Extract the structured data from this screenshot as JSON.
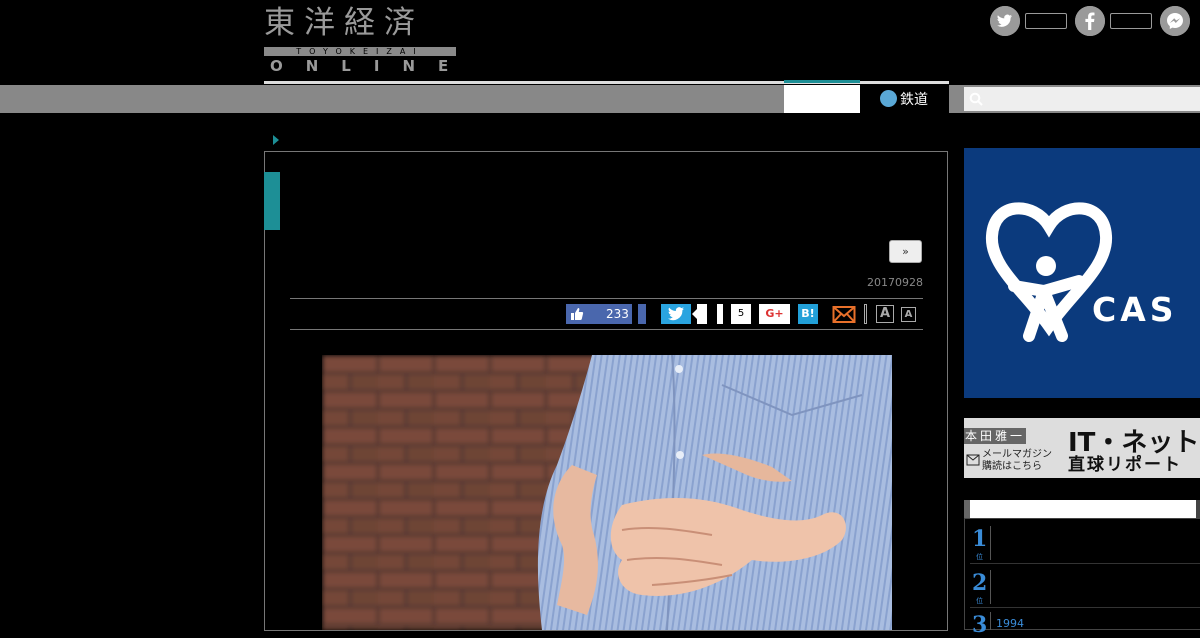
{
  "header": {
    "logo_kanji": "東洋経済",
    "logo_romaji": "TOYOKEIZAI",
    "logo_online": "ONLINE"
  },
  "social": [
    {
      "icon": "twitter-icon",
      "glyph": "t"
    },
    {
      "icon": "facebook-icon",
      "glyph": "f"
    },
    {
      "icon": "messenger-icon",
      "glyph": "m"
    }
  ],
  "nav": {
    "rail_label": "鉄道",
    "search_placeholder": ""
  },
  "article": {
    "next_button": "»",
    "date": "20170928",
    "share": {
      "fb_like_count": "233",
      "count_5": "5",
      "gplus_label": "G+",
      "hatena_label": "B!",
      "font_large": "A",
      "font_small": "A"
    }
  },
  "sidebar": {
    "ad_text": "CAS",
    "banner": {
      "name": "本田雅一",
      "mail_line1": "メールマガジン",
      "mail_line2": "購読はこちら",
      "title": "IT・ネット",
      "subtitle": "直球リポート"
    },
    "ranking": [
      {
        "rank": "1",
        "unit": "位",
        "text": ""
      },
      {
        "rank": "2",
        "unit": "位",
        "text": ""
      },
      {
        "rank": "3",
        "unit": "位",
        "text": "1994"
      }
    ]
  },
  "colors": {
    "accent_teal": "#1d8f96",
    "facebook": "#4a67ad",
    "twitter": "#2aa4e0",
    "hatena": "#22a0d8",
    "rank_blue": "#3a8cd8"
  }
}
